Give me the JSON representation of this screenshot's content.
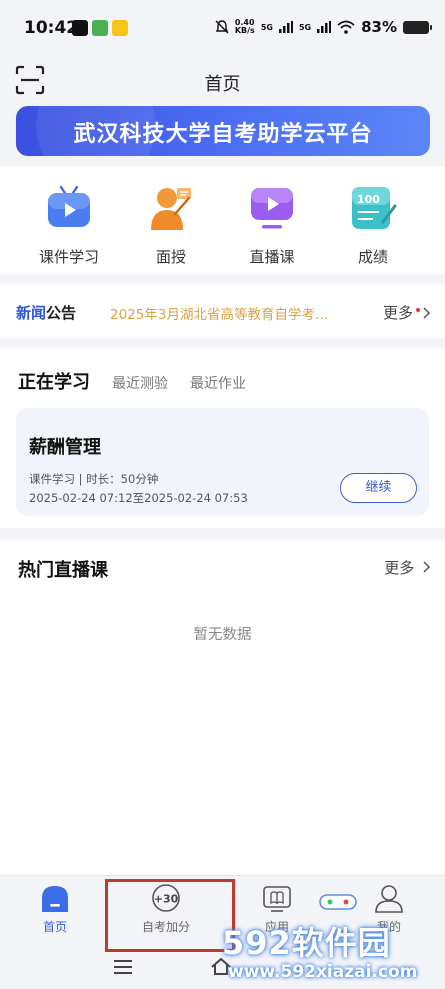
{
  "status_bar": {
    "time": "10:42",
    "speed": "0.40",
    "speed_unit": "KB/s",
    "signal1": "5G",
    "signal2": "5G",
    "battery": "83%"
  },
  "header": {
    "title": "首页"
  },
  "banner": {
    "text": "武汉科技大学自考助学云平台"
  },
  "quick_links": [
    {
      "label": "课件学习",
      "icon": "tv-icon"
    },
    {
      "label": "面授",
      "icon": "teacher-icon"
    },
    {
      "label": "直播课",
      "icon": "live-play-icon"
    },
    {
      "label": "成绩",
      "icon": "score-icon"
    }
  ],
  "news": {
    "tag_a": "新闻",
    "tag_b": "公告",
    "text": "2025年3月湖北省高等教育自学考…",
    "more": "更多"
  },
  "learning": {
    "tab_active": "正在学习",
    "tab_quiz": "最近测验",
    "tab_homework": "最近作业",
    "course": {
      "title": "薪酬管理",
      "meta": "课件学习 | 时长：50分钟",
      "time": "2025-02-24 07:12至2025-02-24 07:53",
      "button": "继续"
    }
  },
  "hot_live": {
    "title": "热门直播课",
    "more": "更多",
    "empty": "暂无数据"
  },
  "bottom_nav": [
    {
      "label": "首页",
      "active": true
    },
    {
      "label": "自考加分",
      "badge": "+30"
    },
    {
      "label": "应用"
    },
    {
      "label": "我的"
    }
  ],
  "watermark": {
    "logo": "592软件园",
    "url": "www.592xiazai.com"
  },
  "colors": {
    "accent": "#3b5bdb",
    "news_highlight": "#d9a445",
    "page_bg": "#f3f4f8"
  }
}
